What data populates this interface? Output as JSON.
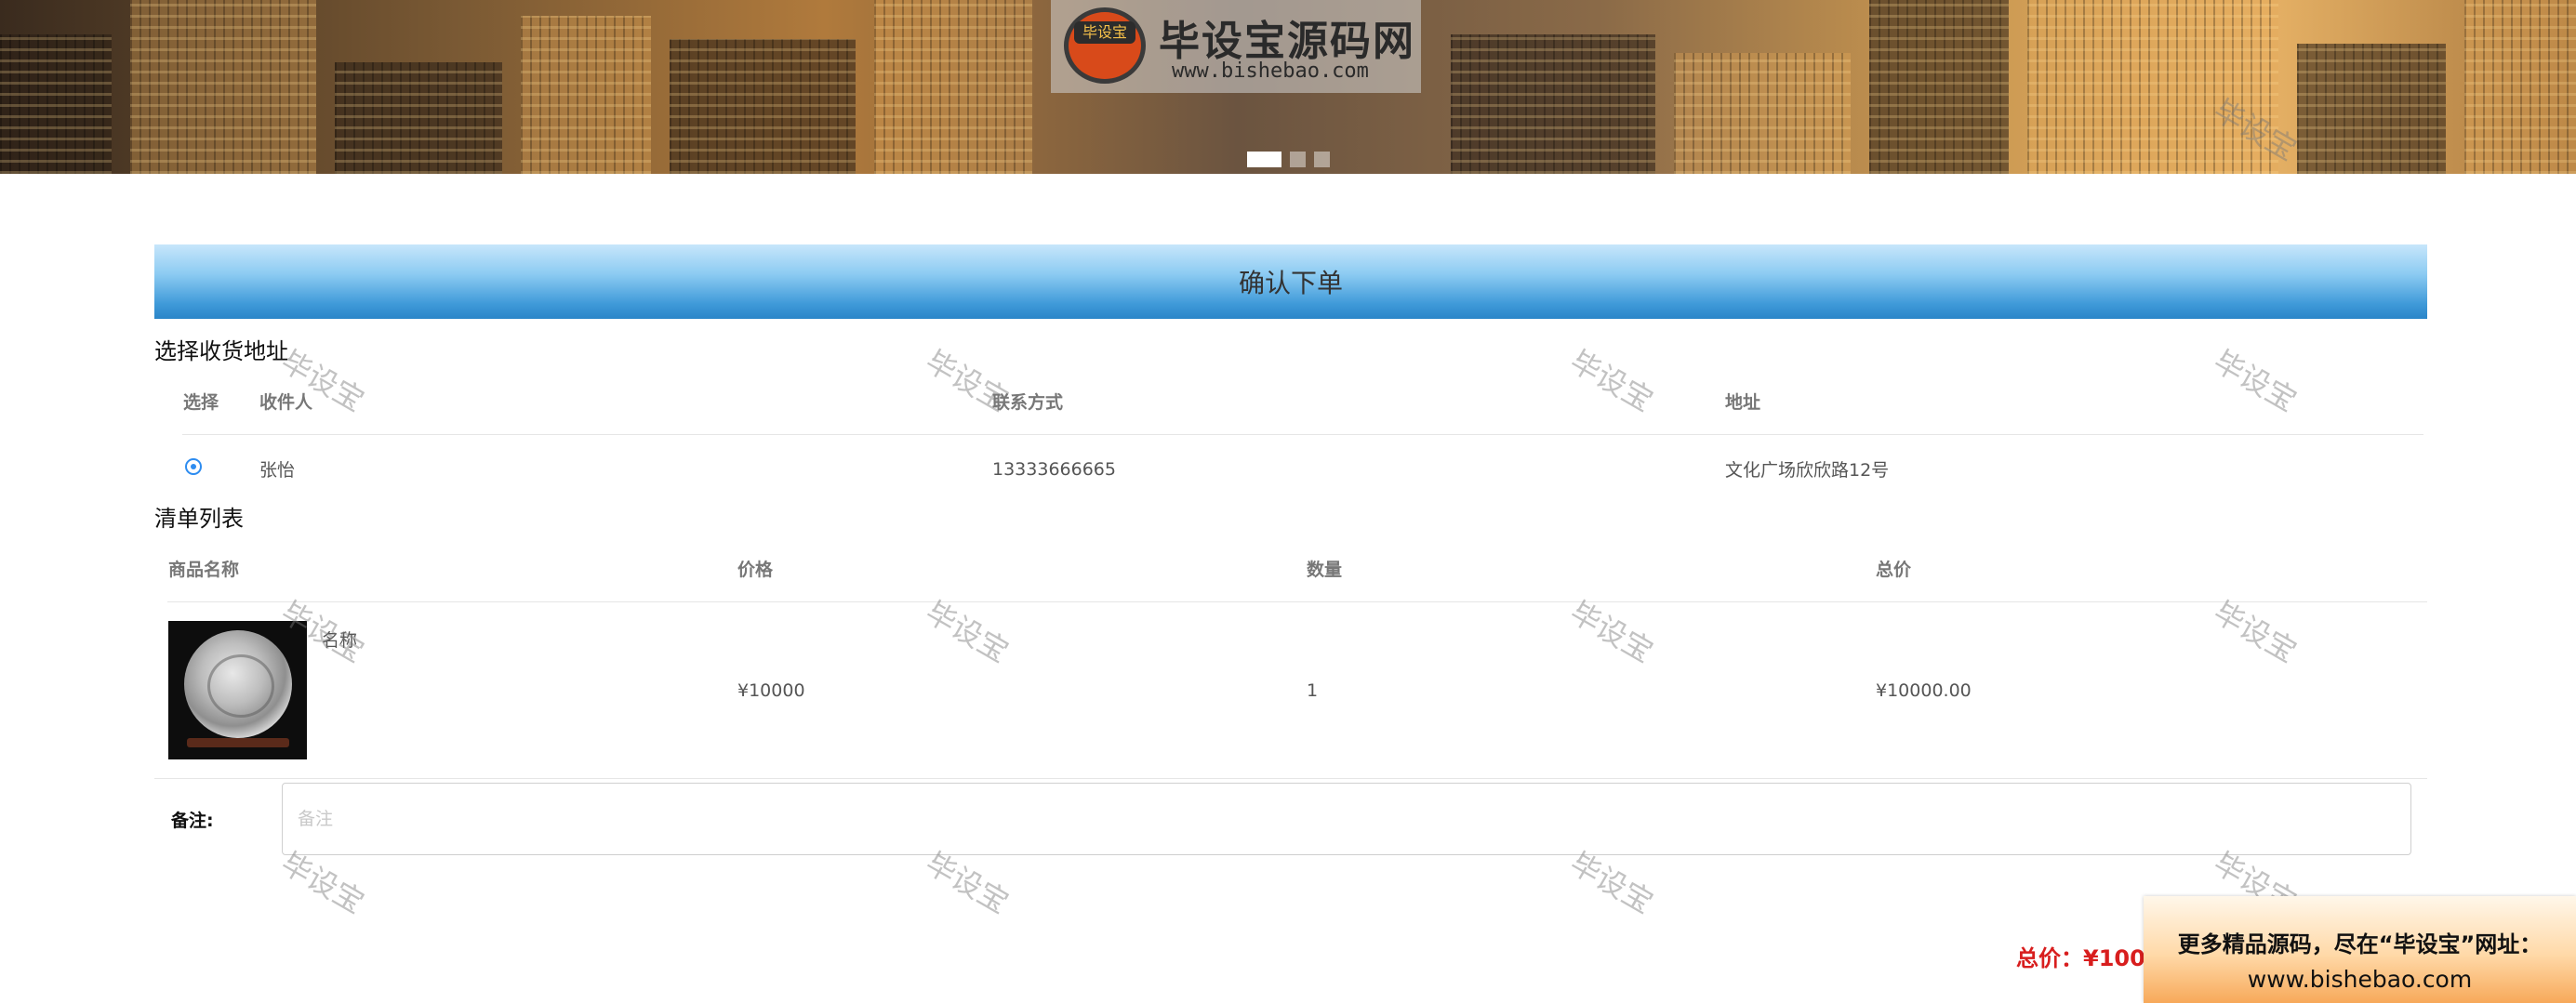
{
  "banner": {
    "logo_badge": "毕设宝",
    "logo_title": "毕设宝源码网",
    "logo_url": "www.bishebao.com",
    "slide_count": 3,
    "active_slide": 1
  },
  "page": {
    "title": "确认下单"
  },
  "address_section": {
    "title": "选择收货地址",
    "headers": {
      "select": "选择",
      "receiver": "收件人",
      "contact": "联系方式",
      "address": "地址"
    },
    "rows": [
      {
        "selected": true,
        "receiver": "张怡",
        "contact": "13333666665",
        "address": "文化广场欣欣路12号"
      }
    ]
  },
  "order_section": {
    "title": "清单列表",
    "headers": {
      "name": "商品名称",
      "price": "价格",
      "quantity": "数量",
      "total": "总价"
    },
    "rows": [
      {
        "name": "名称",
        "price": "¥10000",
        "quantity": "1",
        "total": "¥10000.00"
      }
    ]
  },
  "note": {
    "label": "备注:",
    "placeholder": "备注",
    "value": ""
  },
  "summary": {
    "total_text": "总价：¥100"
  },
  "watermark": "毕设宝",
  "ad": {
    "line1": "更多精品源码，尽在“毕设宝”网址：",
    "line2": "www.bishebao.com"
  },
  "colors": {
    "accent_blue": "#2a85c8",
    "radio_blue": "#2d8cf0",
    "total_red": "#d81e1e"
  }
}
